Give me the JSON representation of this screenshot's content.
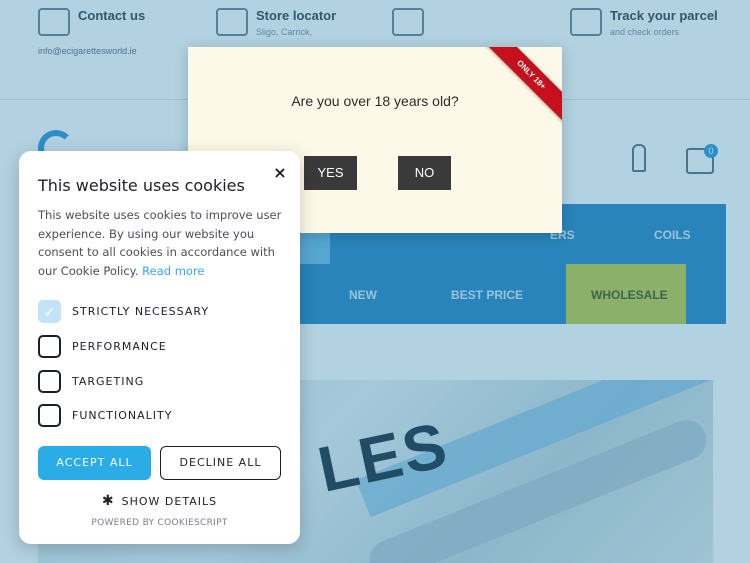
{
  "topbar": {
    "contact_title": "Contact us",
    "contact_email": "info@ecigarettesworld.ie",
    "store_title": "Store locator",
    "store_sub": "Sligo, Carrick,",
    "track_title": "Track your parcel",
    "track_sub": "and check orders"
  },
  "header": {
    "cart_count": "0"
  },
  "nav": {
    "item_coils": "COILS",
    "item_ers": "ERS",
    "item_new": "NEW",
    "item_best_price": "BEST PRICE",
    "item_wholesale": "WHOLESALE"
  },
  "hero": {
    "text": "LES"
  },
  "age_modal": {
    "question": "Are you over 18 years old?",
    "yes_label": "YES",
    "no_label": "NO",
    "ribbon": "ONLY 18+"
  },
  "cookie": {
    "title": "This website uses cookies",
    "close": "×",
    "description": "This website uses cookies to improve user experience. By using our website you consent to all cookies in accordance with our Cookie Policy.",
    "read_more": "Read more",
    "options": [
      {
        "label": "STRICTLY NECESSARY",
        "checked": true
      },
      {
        "label": "PERFORMANCE",
        "checked": false
      },
      {
        "label": "TARGETING",
        "checked": false
      },
      {
        "label": "FUNCTIONALITY",
        "checked": false
      }
    ],
    "accept_label": "ACCEPT ALL",
    "decline_label": "DECLINE ALL",
    "show_details": "SHOW DETAILS",
    "powered_by": "POWERED BY COOKIESCRIPT",
    "accent_color": "#2aace7"
  }
}
